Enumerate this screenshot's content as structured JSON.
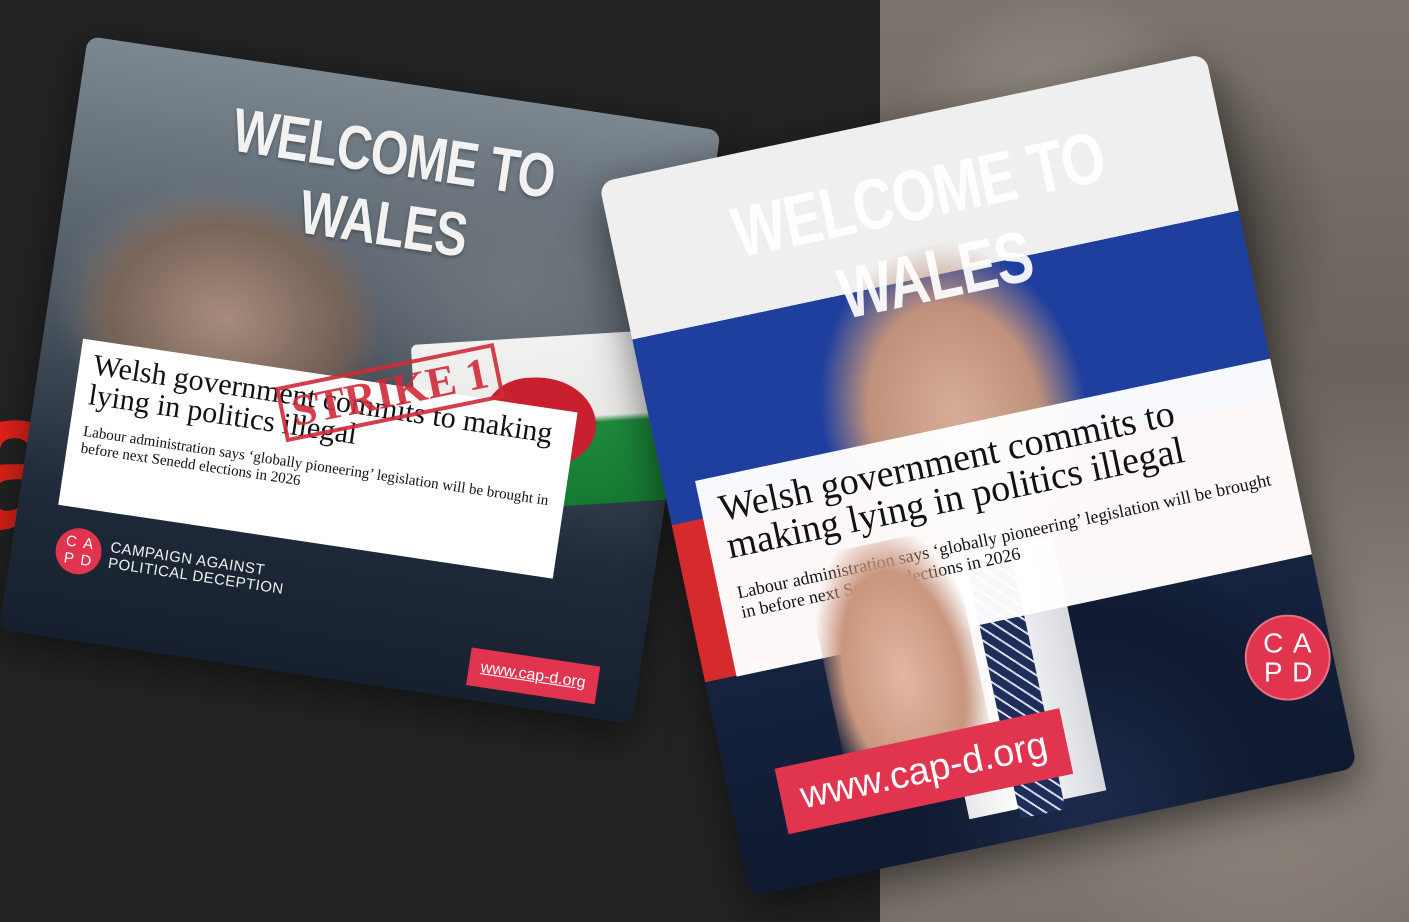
{
  "colors": {
    "accent_red": "#e2231a",
    "brand_pink": "#e0344f",
    "background": "#232323"
  },
  "background_partial_letter": "a",
  "card1": {
    "title": "WELCOME TO WALES",
    "stamp": "STRIKE 1",
    "headline": "Welsh government commits to making lying in politics illegal",
    "subheadline": "Labour administration says ‘globally pioneering’ legislation will be brought in before next Senedd elections in 2026",
    "logo_letters": [
      "C",
      "A",
      "P",
      "D"
    ],
    "org_line1": "CAMPAIGN AGAINST",
    "org_line2": "POLITICAL DECEPTION",
    "url": "www.cap-d.org"
  },
  "card2": {
    "title": "WELCOME TO WALES",
    "headline": "Welsh government commits to making lying in politics illegal",
    "subheadline": "Labour administration says ‘globally pioneering’ legislation will be brought in before next Senedd elections in 2026",
    "logo_letters": [
      "C",
      "A",
      "P",
      "D"
    ],
    "url": "www.cap-d.org"
  }
}
